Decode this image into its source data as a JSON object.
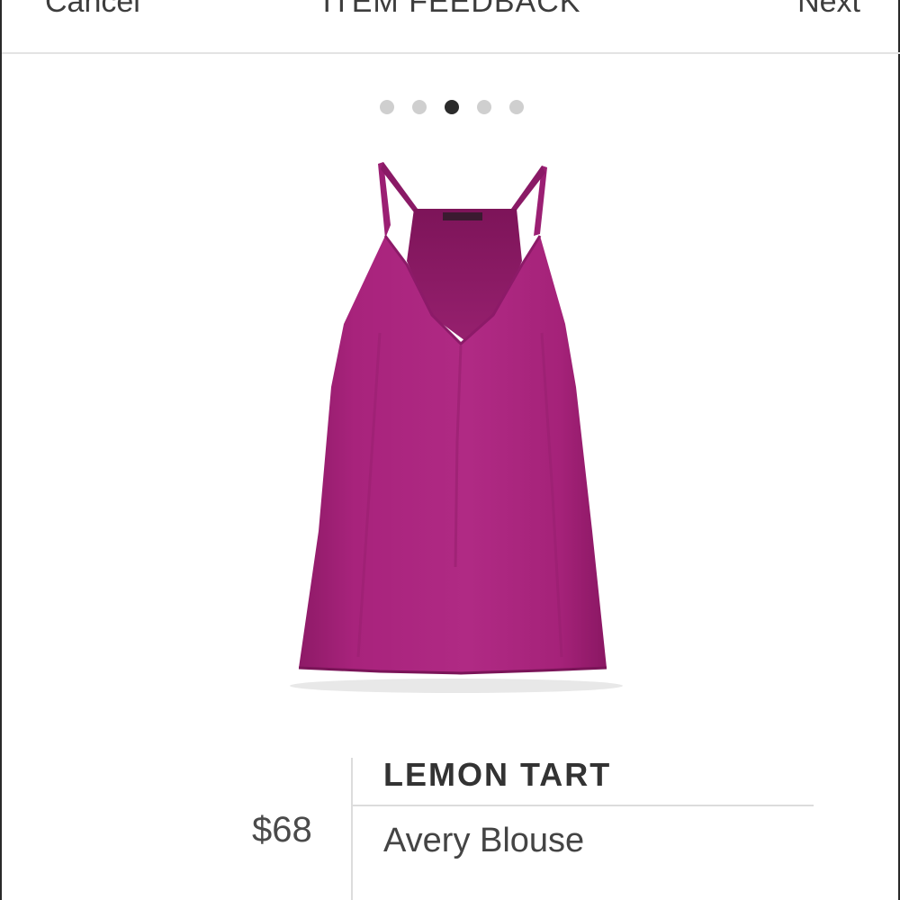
{
  "header": {
    "cancel_label": "Cancel",
    "title": "ITEM FEEDBACK",
    "next_label": "Next"
  },
  "pager": {
    "total": 5,
    "active_index": 3
  },
  "product": {
    "brand": "LEMON TART",
    "name": "Avery Blouse",
    "price": "$68",
    "image_icon": "magenta-camisole-image",
    "tag_text": "lemontart"
  },
  "colors": {
    "garment": "#a8237c",
    "dot_active": "#2b2b2b",
    "dot_inactive": "#cfcfcf",
    "divider": "#dcdcdc"
  }
}
